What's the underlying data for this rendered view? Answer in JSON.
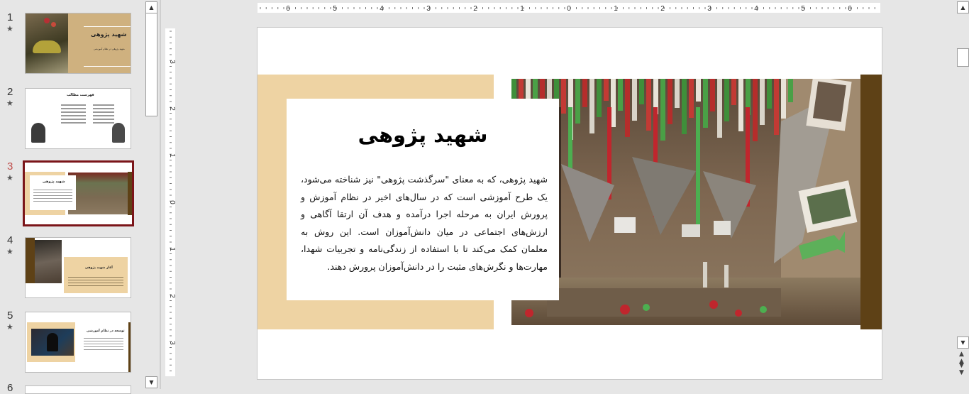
{
  "thumbnails": [
    {
      "number": "1",
      "title": "شهید پژوهی",
      "subtitle": "شهید پژوهی در نظام آموزشی"
    },
    {
      "number": "2",
      "title": "فهرست مطالب"
    },
    {
      "number": "3",
      "title": "شهید پژوهی"
    },
    {
      "number": "4",
      "title": "آغاز شهید پژوهی"
    },
    {
      "number": "5",
      "title": "توسعه در نظام آموزشی"
    },
    {
      "number": "6"
    }
  ],
  "star_glyph": "★",
  "ruler": {
    "horizontal": [
      "6",
      "5",
      "4",
      "3",
      "2",
      "1",
      "0",
      "1",
      "2",
      "3",
      "4",
      "5",
      "6"
    ],
    "vertical": [
      "3",
      "2",
      "1",
      "0",
      "1",
      "2",
      "3"
    ]
  },
  "slide": {
    "title": "شهید پژوهی",
    "body": "شهید پژوهی، که به معنای \"سرگذشت پژوهی\" نیز شناخته می‌شود، یک طرح آموزشی است که در سال‌های اخیر در نظام آموزش و پرورش ایران به مرحله اجرا درآمده و هدف آن ارتقا آگاهی و ارزش‌های اجتماعی در میان دانش‌آموزان است. این روش به معلمان کمک می‌کند تا با استفاده از زندگی‌نامه و تجربیات شهدا، مهارت‌ها و نگرش‌های مثبت را در دانش‌آموزان پرورش دهند."
  },
  "colors": {
    "accent_tan": "#eed3a3",
    "accent_brown": "#5e4116",
    "selection": "#7b1519"
  }
}
